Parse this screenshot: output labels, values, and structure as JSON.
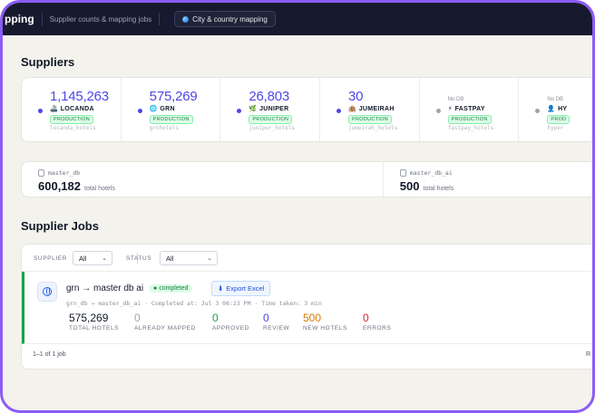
{
  "header": {
    "brand": "pping",
    "subtitle": "Supplier counts & mapping jobs",
    "tab_label": "City & country mapping"
  },
  "suppliers": {
    "title": "Suppliers",
    "items": [
      {
        "count": "1,145,263",
        "nodb": "",
        "icon": "🚢",
        "name": "LOCANDA",
        "status": "PRODUCTION",
        "table": "locanda_hotels",
        "dot_color": "#4f46e5"
      },
      {
        "count": "575,269",
        "nodb": "",
        "icon": "🌐",
        "name": "GRN",
        "status": "PRODUCTION",
        "table": "grnhotels",
        "dot_color": "#4f46e5"
      },
      {
        "count": "26,803",
        "nodb": "",
        "icon": "🌿",
        "name": "JUNIPER",
        "status": "PRODUCTION",
        "table": "juniper_hotels",
        "dot_color": "#4f46e5"
      },
      {
        "count": "30",
        "nodb": "",
        "icon": "🏨",
        "name": "JUMEIRAH",
        "status": "PRODUCTION",
        "table": "jumeirah_hotels",
        "dot_color": "#4f46e5"
      },
      {
        "count": "",
        "nodb": "No DB",
        "icon": "⚡",
        "name": "FASTPAY",
        "status": "PRODUCTION",
        "table": "fastpay_hotels",
        "dot_color": "#9ca3af"
      },
      {
        "count": "",
        "nodb": "No DB",
        "icon": "👤",
        "name": "HY",
        "status": "PROD",
        "table": "hyper",
        "dot_color": "#9ca3af"
      }
    ]
  },
  "databases": [
    {
      "label": "master_db",
      "value": "600,182",
      "suffix": "total hotels"
    },
    {
      "label": "master_db_ai",
      "value": "500",
      "suffix": "total hotels"
    }
  ],
  "jobs": {
    "title": "Supplier Jobs",
    "filters": {
      "supplier_label": "SUPPLIER",
      "supplier_value": "All",
      "status_label": "STATUS",
      "status_value": "All"
    },
    "rows": [
      {
        "title": "grn → master db ai",
        "status": "completed",
        "export_label": "Export Excel",
        "meta": "grn_db → master_db_ai · Completed at: Jul 3 06:23 PM · Time taken: 3 min",
        "stats": [
          {
            "value": "575,269",
            "label": "TOTAL HOTELS",
            "color": "#111827"
          },
          {
            "value": "0",
            "label": "ALREADY MAPPED",
            "color": "#9ca3af"
          },
          {
            "value": "0",
            "label": "APPROVED",
            "color": "#16a34a"
          },
          {
            "value": "0",
            "label": "REVIEW",
            "color": "#4f46e5"
          },
          {
            "value": "500",
            "label": "NEW HOTELS",
            "color": "#d97706"
          },
          {
            "value": "0",
            "label": "ERRORS",
            "color": "#dc2626"
          }
        ]
      }
    ],
    "footer_count": "1–1 of 1 job",
    "footer_right": "R"
  },
  "colors": {
    "accent": "#4f46e5",
    "success": "#16a34a",
    "frame": "#8b5cf6",
    "topbar": "#171a2e"
  }
}
